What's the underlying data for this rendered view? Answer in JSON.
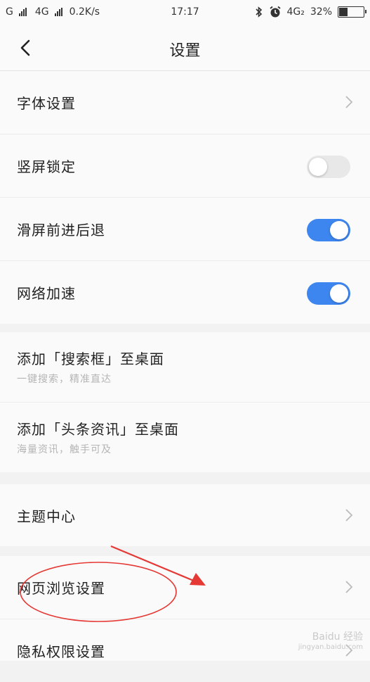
{
  "status_bar": {
    "signal1": "G",
    "signal2": "4G",
    "speed": "0.2K/s",
    "time": "17:17",
    "net_type": "4G₂",
    "battery": "32%",
    "battery_level": 0.32
  },
  "header": {
    "title": "设置"
  },
  "section1": {
    "font_settings": "字体设置",
    "portrait_lock": "竖屏锁定",
    "portrait_lock_on": false,
    "swipe_nav": "滑屏前进后退",
    "swipe_nav_on": true,
    "network_boost": "网络加速",
    "network_boost_on": true
  },
  "section2": {
    "add_search": "添加「搜索框」至桌面",
    "add_search_sub": "一键搜索，精准直达",
    "add_news": "添加「头条资讯」至桌面",
    "add_news_sub": "海量资讯，触手可及"
  },
  "section3": {
    "theme_center": "主题中心"
  },
  "section4": {
    "web_browsing": "网页浏览设置",
    "privacy": "隐私权限设置"
  },
  "watermark": {
    "text": "Baidu 经验",
    "url": "jingyan.baidu.com"
  },
  "colors": {
    "accent": "#3d86f0",
    "annotation": "#e53935"
  }
}
